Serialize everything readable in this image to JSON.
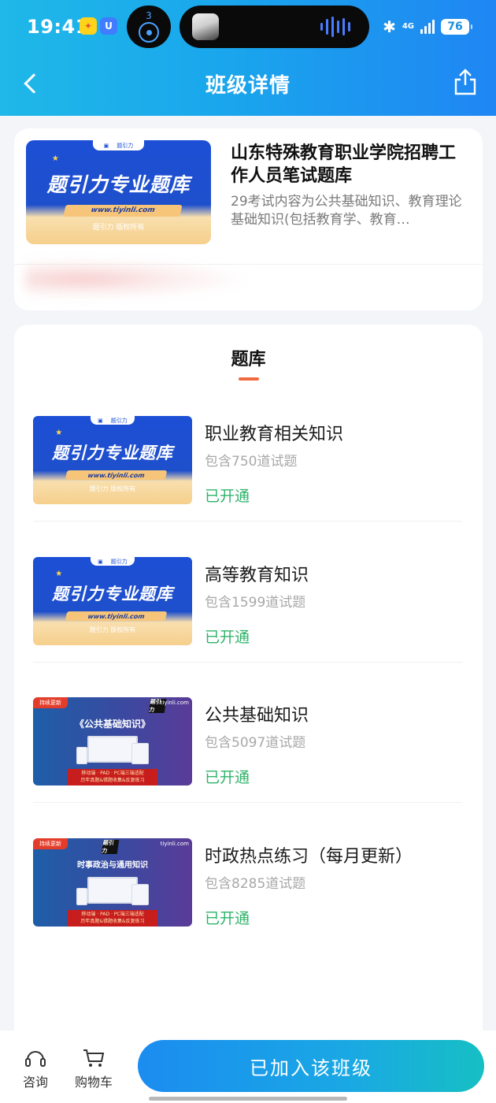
{
  "status_bar": {
    "time": "19:41",
    "notification_badge": "3",
    "network": "4G",
    "battery": "76"
  },
  "header": {
    "title": "班级详情"
  },
  "course": {
    "title": "山东特殊教育职业学院招聘工作人员笔试题库",
    "description": "29考试内容为公共基础知识、教育理论基础知识(包括教育学、教育…"
  },
  "cover_blue": {
    "main_text": "题引力专业题库",
    "url": "www.tiyinli.com",
    "copyright": "题引力 版权所有",
    "logo_text": "题引力"
  },
  "cover_purple": {
    "tag": "持续更新",
    "brand": "tiyinli.com",
    "logo": "题引力",
    "ribbon_line1": "移动端 · PAD · PC端三端适配",
    "ribbon_line2": "历年真题&错题收集&反复练习"
  },
  "bank": {
    "title": "题库",
    "items": [
      {
        "name": "职业教育相关知识",
        "count": "包含750道试题",
        "status": "已开通",
        "cover_title": ""
      },
      {
        "name": "高等教育知识",
        "count": "包含1599道试题",
        "status": "已开通",
        "cover_title": ""
      },
      {
        "name": "公共基础知识",
        "count": "包含5097道试题",
        "status": "已开通",
        "cover_title": "《公共基础知识》"
      },
      {
        "name": "时政热点练习（每月更新）",
        "count": "包含8285道试题",
        "status": "已开通",
        "cover_title": "时事政治与通用知识"
      }
    ]
  },
  "bottom": {
    "consult_label": "咨询",
    "cart_label": "购物车",
    "join_label": "已加入该班级"
  },
  "colors": {
    "header_gradient_start": "#1fb8e8",
    "header_gradient_end": "#1f86f3",
    "opened_status": "#2fb36a",
    "tab_underline": "#f06a3f",
    "join_button_start": "#1b8cf0",
    "join_button_end": "#16bfc4"
  },
  "icons": {
    "back": "back-chevron-icon",
    "share": "share-icon",
    "consult": "headset-icon",
    "cart": "cart-icon",
    "bluetooth": "bluetooth-icon",
    "signal": "signal-icon",
    "battery": "battery-icon"
  }
}
